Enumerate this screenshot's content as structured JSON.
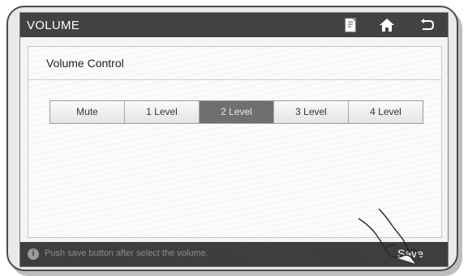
{
  "header": {
    "title": "VOLUME",
    "icons": [
      "note-icon",
      "home-icon",
      "back-icon"
    ]
  },
  "panel": {
    "title": "Volume Control"
  },
  "levels": [
    {
      "label": "Mute",
      "selected": false
    },
    {
      "label": "1 Level",
      "selected": false
    },
    {
      "label": "2 Level",
      "selected": true
    },
    {
      "label": "3 Level",
      "selected": false
    },
    {
      "label": "4 Level",
      "selected": false
    }
  ],
  "footer": {
    "hint": "Push save button after select the volume.",
    "save_label": "Save"
  },
  "colors": {
    "bar": "#3e3e3e",
    "selected": "#6a6a6a"
  }
}
